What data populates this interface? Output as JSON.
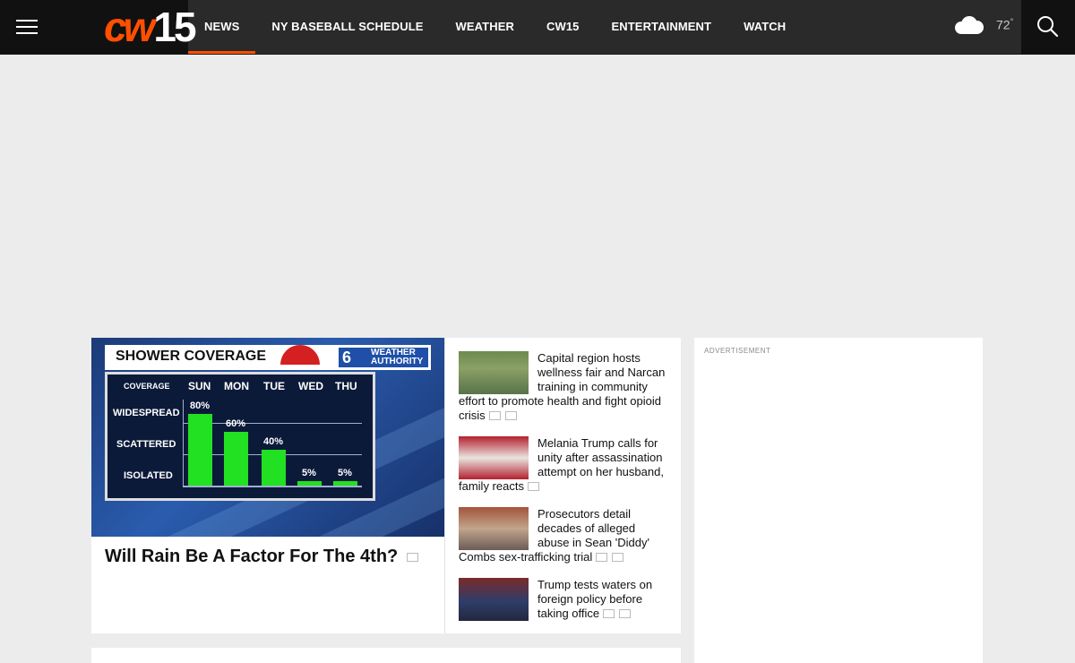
{
  "brand": {
    "logo_cw": "cw",
    "logo_num": "15",
    "accent_color": "#ff4f00"
  },
  "nav": {
    "items": [
      {
        "label": "NEWS",
        "active": true
      },
      {
        "label": "NY BASEBALL SCHEDULE",
        "active": false
      },
      {
        "label": "WEATHER",
        "active": false
      },
      {
        "label": "CW15",
        "active": false
      },
      {
        "label": "ENTERTAINMENT",
        "active": false
      },
      {
        "label": "WATCH",
        "active": false
      }
    ]
  },
  "weather": {
    "icon": "cloud-icon",
    "temp": "72",
    "unit": "°"
  },
  "hero": {
    "title": "Will Rain Be A Factor For The 4th?",
    "graphic": {
      "header": "SHOWER COVERAGE",
      "badge_num": "6",
      "badge_line1": "WEATHER",
      "badge_line2": "AUTHORITY",
      "coverage_label": "COVERAGE",
      "days": [
        "SUN",
        "MON",
        "TUE",
        "WED",
        "THU"
      ],
      "levels": [
        "WIDESPREAD",
        "SCATTERED",
        "ISOLATED"
      ],
      "values": [
        "80%",
        "60%",
        "40%",
        "5%",
        "5%"
      ],
      "fractions": [
        0.8,
        0.6,
        0.4,
        0.05,
        0.05
      ]
    }
  },
  "news": [
    {
      "title": "Capital region hosts wellness fair and Narcan training in community effort to promote health and fight opioid crisis",
      "has_video": true,
      "has_gallery": true
    },
    {
      "title": "Melania Trump calls for unity after assassination attempt on her husband, family reacts",
      "has_video": false,
      "has_gallery": true
    },
    {
      "title": "Prosecutors detail decades of alleged abuse in Sean 'Diddy' Combs sex-trafficking trial",
      "has_video": true,
      "has_gallery": true
    },
    {
      "title": "Trump tests waters on foreign policy before taking office",
      "has_video": true,
      "has_gallery": true
    }
  ],
  "ad": {
    "label": "ADVERTISEMENT"
  }
}
